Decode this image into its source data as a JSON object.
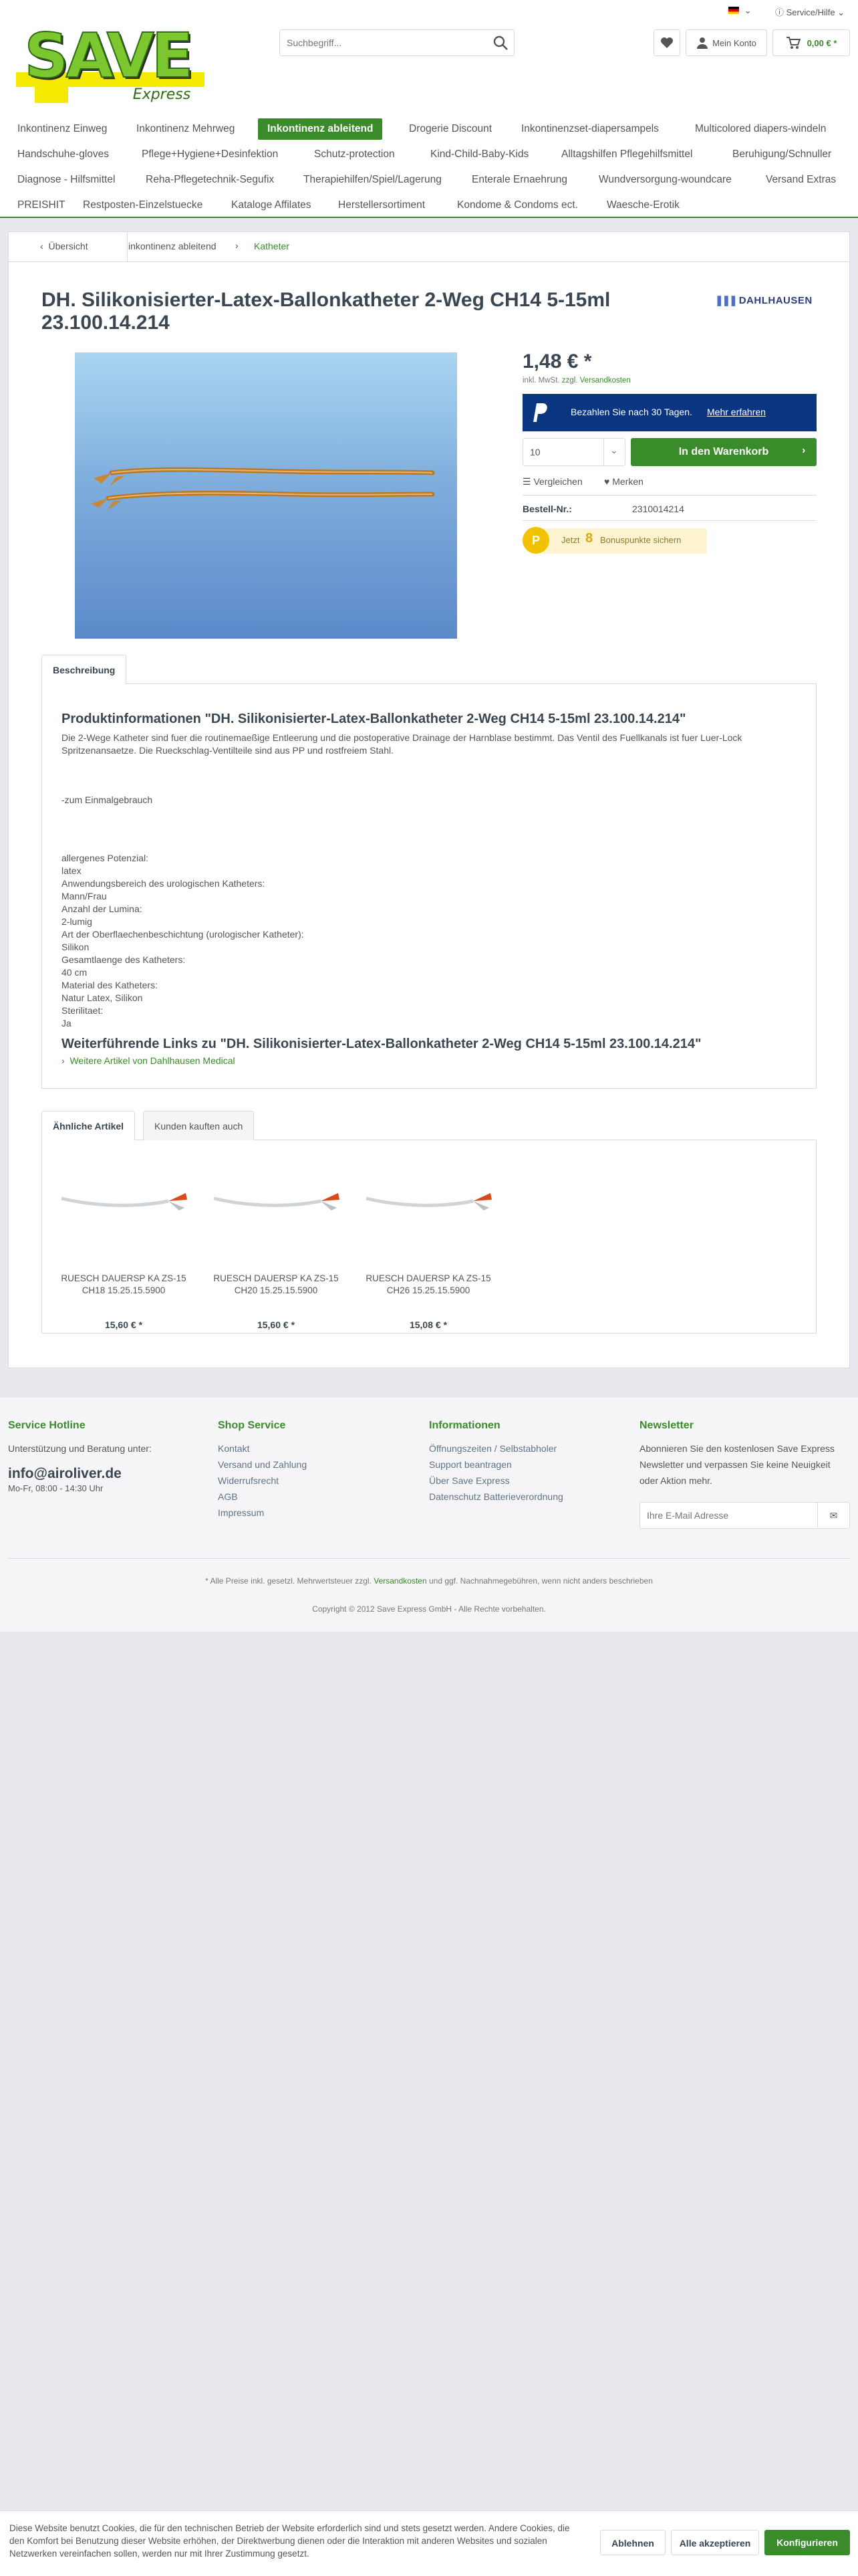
{
  "topbar": {
    "language": "",
    "service": "Service/Hilfe"
  },
  "logo": {
    "word": "SAVE",
    "sub": "Express",
    "brand_color": "#f4e900"
  },
  "search": {
    "placeholder": "Suchbegriff..."
  },
  "header": {
    "account_label": "Mein Konto",
    "cart_total": "0,00 € *"
  },
  "nav": [
    "Inkontinenz Einweg",
    "Inkontinenz Mehrweg",
    "Inkontinenz ableitend",
    "Drogerie Discount",
    "Inkontinenzset-diapersampels",
    "Multicolored diapers-windeln",
    "Handschuhe-gloves",
    "Pflege+Hygiene+Desinfektion",
    "Schutz-protection",
    "Kind-Child-Baby-Kids",
    "Alltagshilfen Pflegehilfsmittel",
    "Beruhigung/Schnuller",
    "Diagnose - Hilfsmittel",
    "Reha-Pflegetechnik-Segufix",
    "Therapiehilfen/Spiel/Lagerung",
    "Enterale Ernaehrung",
    "Wundversorgung-woundcare",
    "Versand Extras",
    "PREISHIT",
    "Restposten-Einzelstuecke",
    "Kataloge Affilates",
    "Herstellersortiment",
    "Kondome & Condoms ect.",
    "Waesche-Erotik"
  ],
  "breadcrumb": {
    "back": "Übersicht",
    "level1": "inkontinenz ableitend",
    "level2": "Katheter"
  },
  "product": {
    "title": "DH. Silikonisierter-Latex-Ballonkatheter 2-Weg CH14 5-15ml 23.100.14.214",
    "manufacturer": "DAHLHAUSEN",
    "price": "1,48 € *",
    "tax_prefix": "inkl. MwSt.",
    "tax_link": "zzgl. Versandkosten",
    "paypal_text": "Bezahlen Sie nach 30 Tagen.",
    "paypal_link": "Mehr erfahren",
    "quantity": "10",
    "cart_button": "In den Warenkorb",
    "compare": "Vergleichen",
    "wishlist": "Merken",
    "order_label": "Bestell-Nr.:",
    "order_number": "2310014214",
    "bonus_prefix": "Jetzt",
    "bonus_points": "8",
    "bonus_suffix": "Bonuspunkte sichern",
    "bonus_badge": "P"
  },
  "tabs": {
    "description": "Beschreibung",
    "similar": "Ähnliche Artikel",
    "also_bought": "Kunden kauften auch"
  },
  "description": {
    "heading": "Produktinformationen \"DH. Silikonisierter-Latex-Ballonkatheter 2-Weg CH14 5-15ml 23.100.14.214\"",
    "intro": "Die 2-Wege Katheter sind fuer die routinemaeßige Entleerung und die postoperative Drainage der Harnblase bestimmt. Das Ventil des Fuellkanals ist fuer Luer-Lock Spritzenansaetze. Die Rueckschlag-Ventilteile sind aus PP und rostfreiem Stahl.",
    "single_use": "-zum Einmalgebrauch",
    "specs": [
      "allergenes Potenzial:",
      "latex",
      "Anwendungsbereich des urologischen Katheters:",
      "Mann/Frau",
      "Anzahl der Lumina:",
      "2-lumig",
      "Art der Oberflaechenbeschichtung (urologischer Katheter):",
      "Silikon",
      "Gesamtlaenge des Katheters:",
      "40 cm",
      "Material des Katheters:",
      "Natur Latex, Silikon",
      "Sterilitaet:",
      "Ja"
    ],
    "links_heading": "Weiterführende Links zu \"DH. Silikonisierter-Latex-Ballonkatheter 2-Weg CH14 5-15ml 23.100.14.214\"",
    "links_item": "Weitere Artikel von Dahlhausen Medical"
  },
  "similar": [
    {
      "line1": "RUESCH DAUERSP KA ZS-15",
      "line2": "CH18 15.25.15.5900",
      "price": "15,60 € *"
    },
    {
      "line1": "RUESCH DAUERSP KA ZS-15",
      "line2": "CH20 15.25.15.5900",
      "price": "15,60 € *"
    },
    {
      "line1": "RUESCH DAUERSP KA ZS-15",
      "line2": "CH26 15.25.15.5900",
      "price": "15,08 € *"
    }
  ],
  "footer": {
    "hotline_title": "Service Hotline",
    "hotline_text": "Unterstützung und Beratung unter:",
    "hotline_email": "info@airoliver.de",
    "hotline_hours": "Mo-Fr, 08:00 - 14:30 Uhr",
    "shop_title": "Shop Service",
    "shop_links": [
      "Kontakt",
      "Versand und Zahlung",
      "Widerrufsrecht",
      "AGB",
      "Impressum"
    ],
    "info_title": "Informationen",
    "info_links": [
      "Öffnungszeiten / Selbstabholer",
      "Support beantragen",
      "Über Save Express",
      "Datenschutz Batterieverordnung"
    ],
    "newsletter_title": "Newsletter",
    "newsletter_text": "Abonnieren Sie den kostenlosen Save Express Newsletter und verpassen Sie keine Neuigkeit oder Aktion mehr.",
    "newsletter_placeholder": "Ihre E-Mail Adresse",
    "note_before": "* Alle Preise inkl. gesetzl. Mehrwertsteuer zzgl.",
    "note_link": "Versandkosten",
    "note_after": "und ggf. Nachnahmegebühren, wenn nicht anders beschrieben",
    "copyright": "Copyright © 2012 Save Express GmbH - Alle Rechte vorbehalten."
  },
  "cookie": {
    "text": "Diese Website benutzt Cookies, die für den technischen Betrieb der Website erforderlich sind und stets gesetzt werden. Andere Cookies, die den Komfort bei Benutzung dieser Website erhöhen, der Direktwerbung dienen oder die Interaktion mit anderen Websites und sozialen Netzwerken vereinfachen sollen, werden nur mit Ihrer Zustimmung gesetzt.",
    "decline": "Ablehnen",
    "accept_all": "Alle akzeptieren",
    "configure": "Konfigurieren"
  },
  "colors": {
    "accent": "#3a8b2a",
    "paypal": "#0a3580",
    "bonus": "#f2c200",
    "heading": "#3a4651"
  }
}
